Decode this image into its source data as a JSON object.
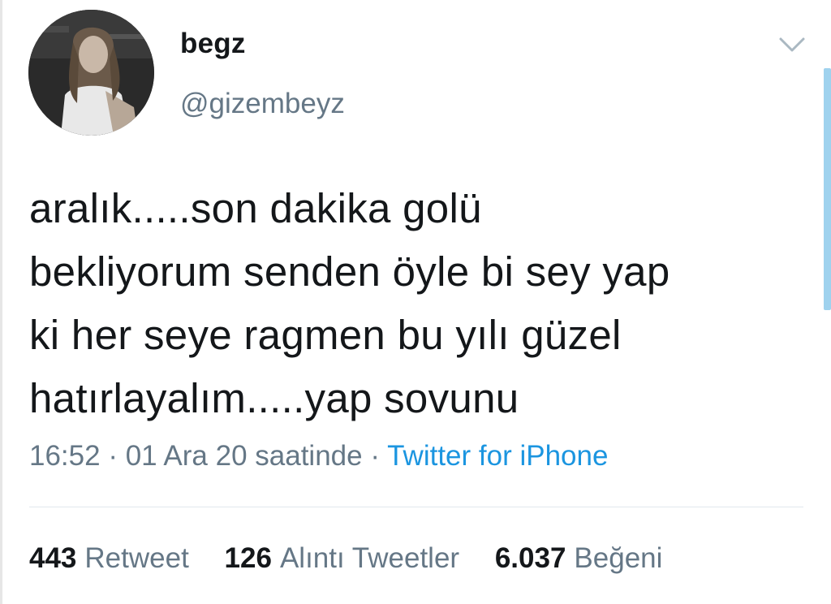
{
  "user": {
    "display_name": "begz",
    "handle": "@gizembeyz",
    "avatar_icon": "profile-photo"
  },
  "tweet": {
    "text": "aralık.....son dakika golü\nbekliyorum senden öyle bi sey yap\nki her seye ragmen bu yılı güzel\nhatırlayalım.....yap sovunu",
    "time": "16:52",
    "separator": " · ",
    "date": "01 Ara 20 saatinde",
    "source": "Twitter for iPhone"
  },
  "stats": {
    "retweets_count": "443",
    "retweets_label": "Retweet",
    "quotes_count": "126",
    "quotes_label": "Alıntı Tweetler",
    "likes_count": "6.037",
    "likes_label": "Beğeni"
  },
  "colors": {
    "text": "#14171a",
    "secondary": "#657786",
    "link": "#1b95e0",
    "divider": "#e1e8ed"
  },
  "icons": {
    "menu": "chevron-down-icon"
  }
}
